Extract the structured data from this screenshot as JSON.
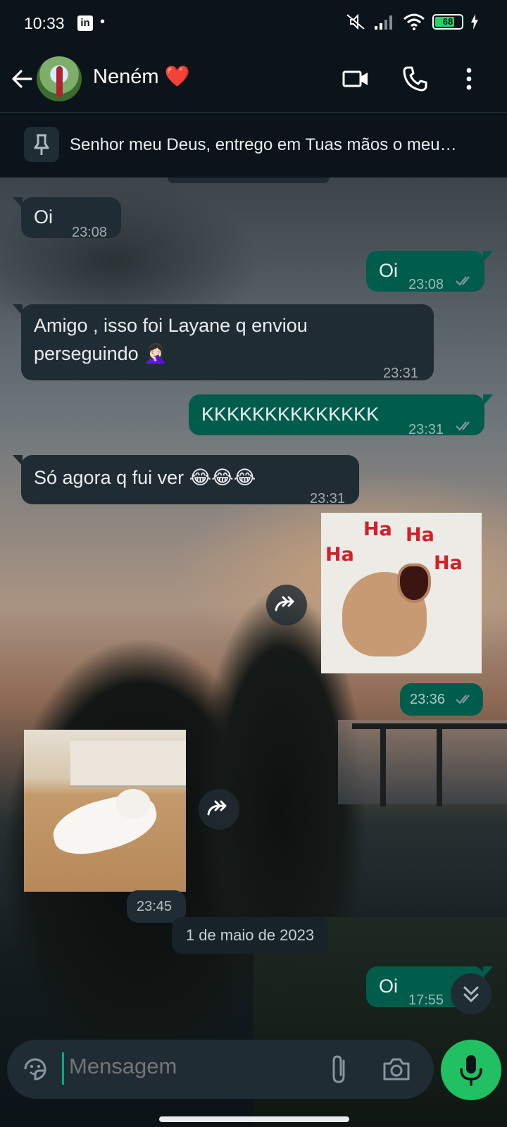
{
  "status_bar": {
    "time": "10:33",
    "notif_app": "in",
    "dot": "•",
    "battery": "68"
  },
  "header": {
    "contact_name": "Neném ❤️"
  },
  "pinned": {
    "text": "Senhor meu Deus, entrego em Tuas mãos o meu…"
  },
  "messages": [
    {
      "dir": "in",
      "text": "Oi",
      "time": "23:08"
    },
    {
      "dir": "out",
      "text": "Oi",
      "time": "23:08"
    },
    {
      "dir": "in",
      "line1": "Amigo , isso foi Layane q enviou",
      "line2": "perseguindo 🤦🏻‍♀️",
      "time": "23:31"
    },
    {
      "dir": "out",
      "text": "KKKKKKKKKKKKKK",
      "time": "23:31"
    },
    {
      "dir": "in",
      "text": "Só agora q fui ver 😂😂😂",
      "time": "23:31"
    },
    {
      "dir": "out",
      "type": "sticker-dog",
      "time": "23:36",
      "sticker_text": [
        "Ha",
        "Ha",
        "Ha",
        "Ha"
      ]
    },
    {
      "dir": "in",
      "type": "sticker-cat",
      "time": "23:45"
    },
    {
      "dir": "out",
      "text": "Oi",
      "time": "17:55"
    }
  ],
  "date_chip": "1 de maio de 2023",
  "composer": {
    "placeholder": "Mensagem"
  },
  "colors": {
    "incoming": "#202c33",
    "outgoing": "#005c4b",
    "accent": "#21c063",
    "ticks": "#8696a0"
  }
}
